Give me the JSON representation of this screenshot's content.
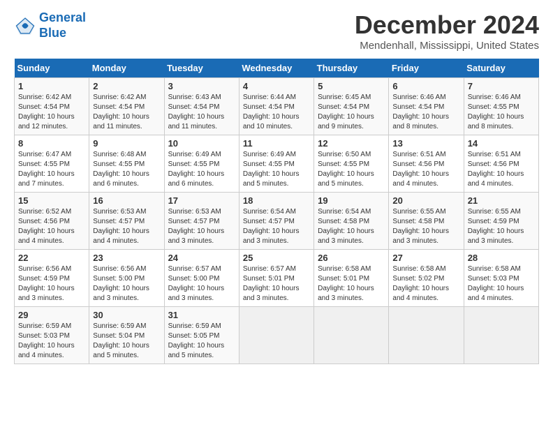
{
  "logo": {
    "line1": "General",
    "line2": "Blue"
  },
  "title": "December 2024",
  "location": "Mendenhall, Mississippi, United States",
  "headers": [
    "Sunday",
    "Monday",
    "Tuesday",
    "Wednesday",
    "Thursday",
    "Friday",
    "Saturday"
  ],
  "weeks": [
    [
      {
        "day": "1",
        "sunrise": "6:42 AM",
        "sunset": "4:54 PM",
        "daylight": "10 hours and 12 minutes."
      },
      {
        "day": "2",
        "sunrise": "6:42 AM",
        "sunset": "4:54 PM",
        "daylight": "10 hours and 11 minutes."
      },
      {
        "day": "3",
        "sunrise": "6:43 AM",
        "sunset": "4:54 PM",
        "daylight": "10 hours and 11 minutes."
      },
      {
        "day": "4",
        "sunrise": "6:44 AM",
        "sunset": "4:54 PM",
        "daylight": "10 hours and 10 minutes."
      },
      {
        "day": "5",
        "sunrise": "6:45 AM",
        "sunset": "4:54 PM",
        "daylight": "10 hours and 9 minutes."
      },
      {
        "day": "6",
        "sunrise": "6:46 AM",
        "sunset": "4:54 PM",
        "daylight": "10 hours and 8 minutes."
      },
      {
        "day": "7",
        "sunrise": "6:46 AM",
        "sunset": "4:55 PM",
        "daylight": "10 hours and 8 minutes."
      }
    ],
    [
      {
        "day": "8",
        "sunrise": "6:47 AM",
        "sunset": "4:55 PM",
        "daylight": "10 hours and 7 minutes."
      },
      {
        "day": "9",
        "sunrise": "6:48 AM",
        "sunset": "4:55 PM",
        "daylight": "10 hours and 6 minutes."
      },
      {
        "day": "10",
        "sunrise": "6:49 AM",
        "sunset": "4:55 PM",
        "daylight": "10 hours and 6 minutes."
      },
      {
        "day": "11",
        "sunrise": "6:49 AM",
        "sunset": "4:55 PM",
        "daylight": "10 hours and 5 minutes."
      },
      {
        "day": "12",
        "sunrise": "6:50 AM",
        "sunset": "4:55 PM",
        "daylight": "10 hours and 5 minutes."
      },
      {
        "day": "13",
        "sunrise": "6:51 AM",
        "sunset": "4:56 PM",
        "daylight": "10 hours and 4 minutes."
      },
      {
        "day": "14",
        "sunrise": "6:51 AM",
        "sunset": "4:56 PM",
        "daylight": "10 hours and 4 minutes."
      }
    ],
    [
      {
        "day": "15",
        "sunrise": "6:52 AM",
        "sunset": "4:56 PM",
        "daylight": "10 hours and 4 minutes."
      },
      {
        "day": "16",
        "sunrise": "6:53 AM",
        "sunset": "4:57 PM",
        "daylight": "10 hours and 4 minutes."
      },
      {
        "day": "17",
        "sunrise": "6:53 AM",
        "sunset": "4:57 PM",
        "daylight": "10 hours and 3 minutes."
      },
      {
        "day": "18",
        "sunrise": "6:54 AM",
        "sunset": "4:57 PM",
        "daylight": "10 hours and 3 minutes."
      },
      {
        "day": "19",
        "sunrise": "6:54 AM",
        "sunset": "4:58 PM",
        "daylight": "10 hours and 3 minutes."
      },
      {
        "day": "20",
        "sunrise": "6:55 AM",
        "sunset": "4:58 PM",
        "daylight": "10 hours and 3 minutes."
      },
      {
        "day": "21",
        "sunrise": "6:55 AM",
        "sunset": "4:59 PM",
        "daylight": "10 hours and 3 minutes."
      }
    ],
    [
      {
        "day": "22",
        "sunrise": "6:56 AM",
        "sunset": "4:59 PM",
        "daylight": "10 hours and 3 minutes."
      },
      {
        "day": "23",
        "sunrise": "6:56 AM",
        "sunset": "5:00 PM",
        "daylight": "10 hours and 3 minutes."
      },
      {
        "day": "24",
        "sunrise": "6:57 AM",
        "sunset": "5:00 PM",
        "daylight": "10 hours and 3 minutes."
      },
      {
        "day": "25",
        "sunrise": "6:57 AM",
        "sunset": "5:01 PM",
        "daylight": "10 hours and 3 minutes."
      },
      {
        "day": "26",
        "sunrise": "6:58 AM",
        "sunset": "5:01 PM",
        "daylight": "10 hours and 3 minutes."
      },
      {
        "day": "27",
        "sunrise": "6:58 AM",
        "sunset": "5:02 PM",
        "daylight": "10 hours and 4 minutes."
      },
      {
        "day": "28",
        "sunrise": "6:58 AM",
        "sunset": "5:03 PM",
        "daylight": "10 hours and 4 minutes."
      }
    ],
    [
      {
        "day": "29",
        "sunrise": "6:59 AM",
        "sunset": "5:03 PM",
        "daylight": "10 hours and 4 minutes."
      },
      {
        "day": "30",
        "sunrise": "6:59 AM",
        "sunset": "5:04 PM",
        "daylight": "10 hours and 5 minutes."
      },
      {
        "day": "31",
        "sunrise": "6:59 AM",
        "sunset": "5:05 PM",
        "daylight": "10 hours and 5 minutes."
      },
      null,
      null,
      null,
      null
    ]
  ]
}
